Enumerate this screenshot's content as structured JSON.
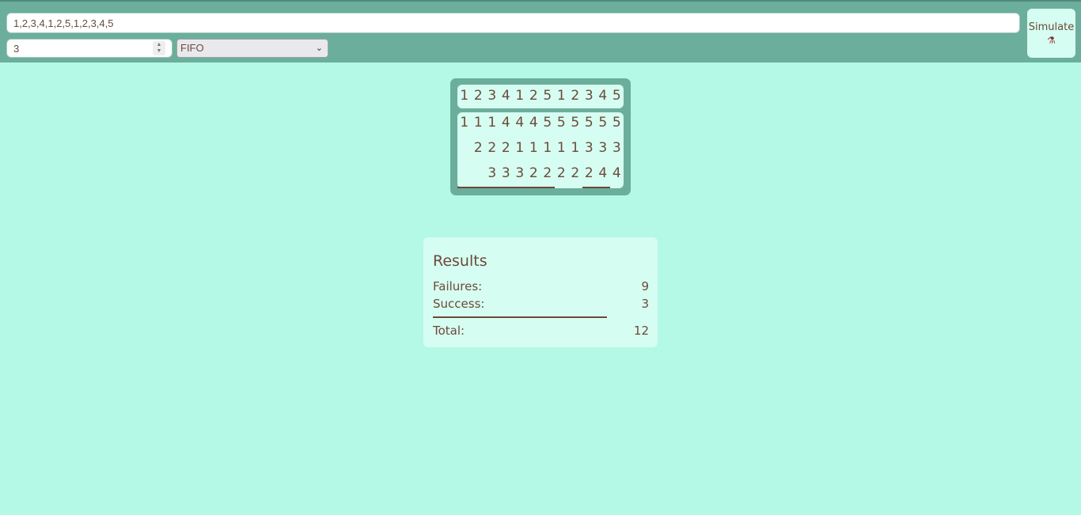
{
  "toolbar": {
    "sequence_value": "1,2,3,4,1,2,5,1,2,3,4,5",
    "frames_value": "3",
    "algorithm_selected": "FIFO",
    "simulate_label": "Simulate",
    "simulate_icon": "flask-icon"
  },
  "simulation": {
    "reference": [
      "1",
      "2",
      "3",
      "4",
      "1",
      "2",
      "5",
      "1",
      "2",
      "3",
      "4",
      "5"
    ],
    "frames": [
      [
        "1",
        "1",
        "1",
        "4",
        "4",
        "4",
        "5",
        "5",
        "5",
        "5",
        "5",
        "5"
      ],
      [
        "",
        "2",
        "2",
        "2",
        "1",
        "1",
        "1",
        "1",
        "1",
        "3",
        "3",
        "3"
      ],
      [
        "",
        "",
        "3",
        "3",
        "3",
        "2",
        "2",
        "2",
        "2",
        "2",
        "4",
        "4"
      ]
    ],
    "hits": [
      false,
      false,
      false,
      false,
      false,
      false,
      false,
      true,
      true,
      false,
      false,
      true
    ]
  },
  "results": {
    "title": "Results",
    "failures_label": "Failures:",
    "failures_value": "9",
    "success_label": "Success:",
    "success_value": "3",
    "total_label": "Total:",
    "total_value": "12"
  },
  "colors": {
    "background": "#b3f9e5",
    "toolbar": "#6cae9c",
    "card": "#d6fdf1",
    "text": "#6b4a3a"
  }
}
